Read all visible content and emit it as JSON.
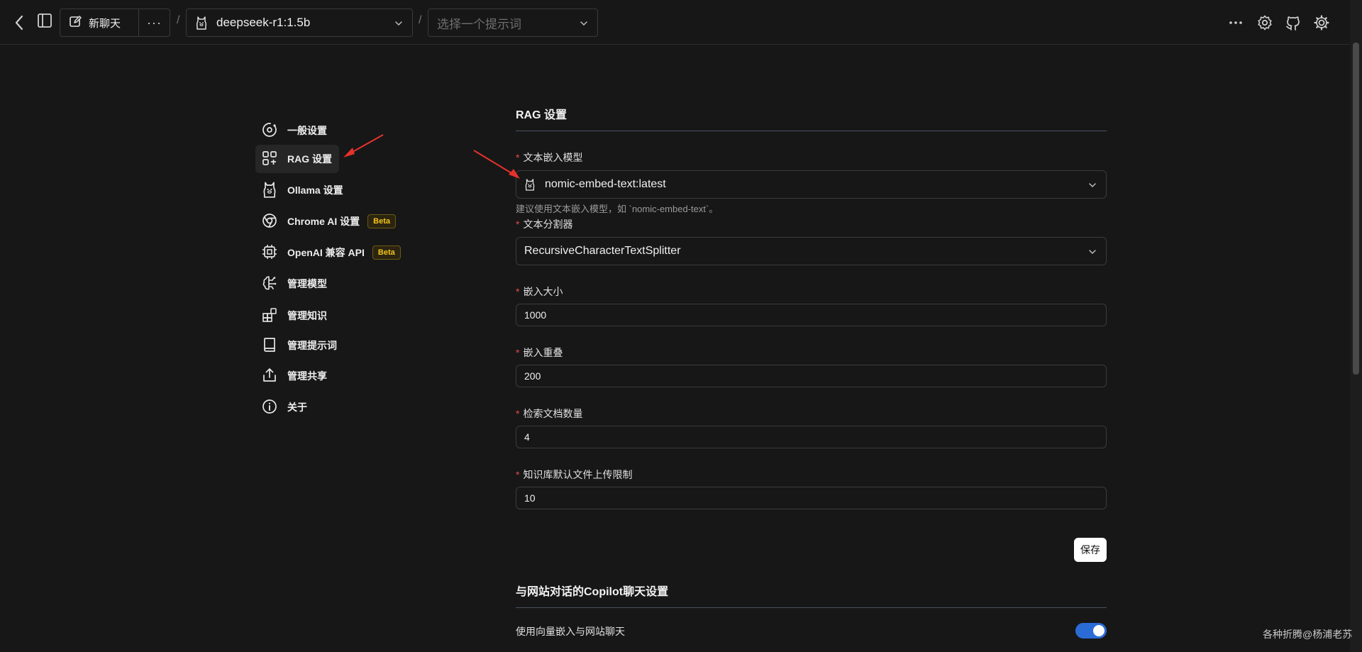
{
  "header": {
    "new_chat_label": "新聊天",
    "more_label": "···",
    "separator": "/",
    "model_select_value": "deepseek-r1:1.5b",
    "prompt_select_placeholder": "选择一个提示词"
  },
  "sidebar": {
    "items": [
      {
        "label": "一般设置",
        "icon": "settings-orbit-icon"
      },
      {
        "label": "RAG 设置",
        "icon": "rag-icon"
      },
      {
        "label": "Ollama 设置",
        "icon": "ollama-icon"
      },
      {
        "label": "Chrome AI 设置",
        "icon": "chrome-icon",
        "badge": "Beta"
      },
      {
        "label": "OpenAI 兼容 API",
        "icon": "cpu-icon",
        "badge": "Beta"
      },
      {
        "label": "管理模型",
        "icon": "brain-icon"
      },
      {
        "label": "管理知识",
        "icon": "blocks-icon"
      },
      {
        "label": "管理提示词",
        "icon": "book-icon"
      },
      {
        "label": "管理共享",
        "icon": "share-icon"
      },
      {
        "label": "关于",
        "icon": "info-icon"
      }
    ],
    "active_index": 1
  },
  "rag": {
    "title": "RAG 设置",
    "embedding_model_label": "文本嵌入模型",
    "embedding_model_value": "nomic-embed-text:latest",
    "embedding_model_hint": "建议使用文本嵌入模型，如 `nomic-embed-text`。",
    "splitter_label": "文本分割器",
    "splitter_value": "RecursiveCharacterTextSplitter",
    "chunk_size_label": "嵌入大小",
    "chunk_size_value": "1000",
    "chunk_overlap_label": "嵌入重叠",
    "chunk_overlap_value": "200",
    "doc_count_label": "检索文档数量",
    "doc_count_value": "4",
    "upload_limit_label": "知识库默认文件上传限制",
    "upload_limit_value": "10",
    "save_label": "保存",
    "required_mark": "*"
  },
  "copilot": {
    "title": "与网站对话的Copilot聊天设置",
    "vector_chat_label": "使用向量嵌入与网站聊天",
    "vector_chat_enabled": true
  },
  "watermark": "各种折腾@杨浦老苏",
  "colors": {
    "background": "#171717",
    "accent": "#2b6bd6",
    "required": "#e5484d",
    "beta": "#f5c518",
    "annotation_arrow": "#e5322d"
  }
}
